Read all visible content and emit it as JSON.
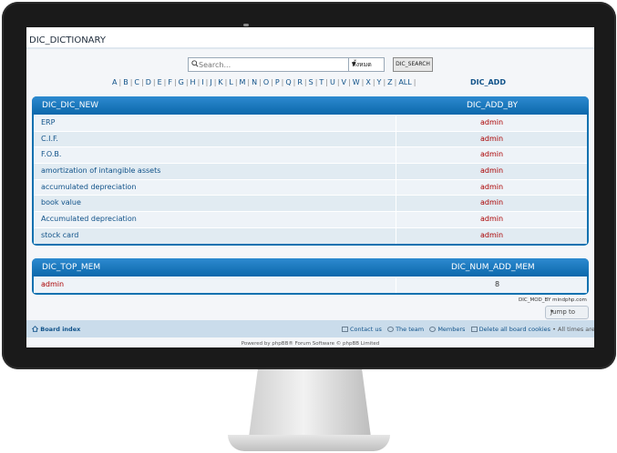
{
  "page": {
    "title": "DIC_DICTIONARY"
  },
  "search": {
    "placeholder": "Search...",
    "scope_selected": "ทั้งหมด",
    "button_label": "DIC_SEARCH"
  },
  "alphabet": [
    "A",
    "B",
    "C",
    "D",
    "E",
    "F",
    "G",
    "H",
    "I",
    "J",
    "K",
    "L",
    "M",
    "N",
    "O",
    "P",
    "Q",
    "R",
    "S",
    "T",
    "U",
    "V",
    "W",
    "X",
    "Y",
    "Z",
    "ALL"
  ],
  "add_link": "DIC_ADD",
  "new_table": {
    "headers": [
      "DIC_DIC_NEW",
      "DIC_ADD_BY"
    ],
    "rows": [
      [
        "ERP",
        "admin"
      ],
      [
        "C.I.F.",
        "admin"
      ],
      [
        "F.O.B.",
        "admin"
      ],
      [
        "amortization of intangible assets",
        "admin"
      ],
      [
        "accumulated depreciation",
        "admin"
      ],
      [
        "book value",
        "admin"
      ],
      [
        "Accumulated depreciation",
        "admin"
      ],
      [
        "stock card",
        "admin"
      ]
    ]
  },
  "top_table": {
    "headers": [
      "DIC_TOP_MEM",
      "DIC_NUM_ADD_MEM"
    ],
    "rows": [
      [
        "admin",
        "8"
      ]
    ]
  },
  "mod_by": "DIC_MOD_BY mindphp.com",
  "jump_to": "Jump to",
  "footer": {
    "board_index": "Board index",
    "contact": "Contact us",
    "team": "The team",
    "members": "Members",
    "delete_cookies": "Delete all board cookies",
    "timezone": "All times are UTC"
  },
  "powered_by": "Powered by phpBB® Forum Software © phpBB Limited",
  "colors": {
    "header_blue": "#0c68ab",
    "link_blue": "#105289",
    "admin_red": "#aa0000"
  }
}
